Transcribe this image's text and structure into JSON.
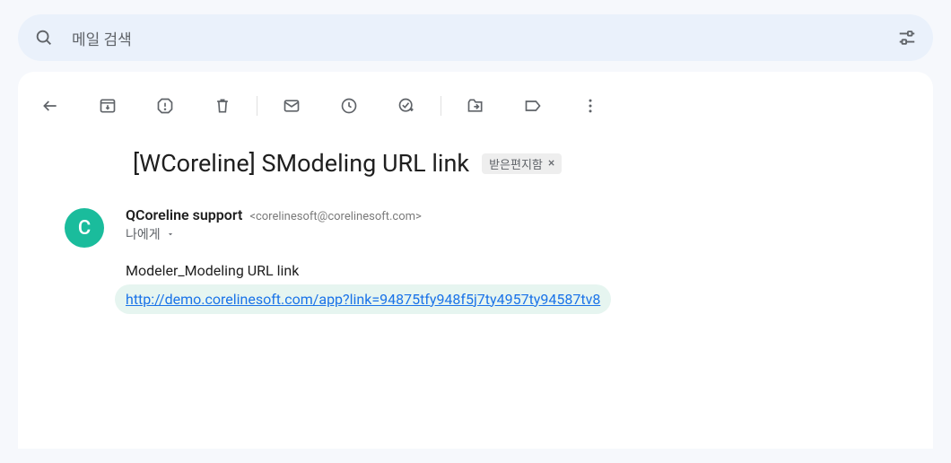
{
  "search": {
    "placeholder": "메일 검색"
  },
  "subject": "[WCoreline] SModeling URL link",
  "label": "받은편지함",
  "sender": {
    "avatar_initial": "C",
    "name": "QCoreline support",
    "email": "<corelinesoft@corelinesoft.com>"
  },
  "recipient": "나에게",
  "body": {
    "line1": "Modeler_Modeling URL link",
    "link_text": "http://demo.corelinesoft.com/app?link=94875tfy948f5j7ty4957ty94587tv8"
  }
}
